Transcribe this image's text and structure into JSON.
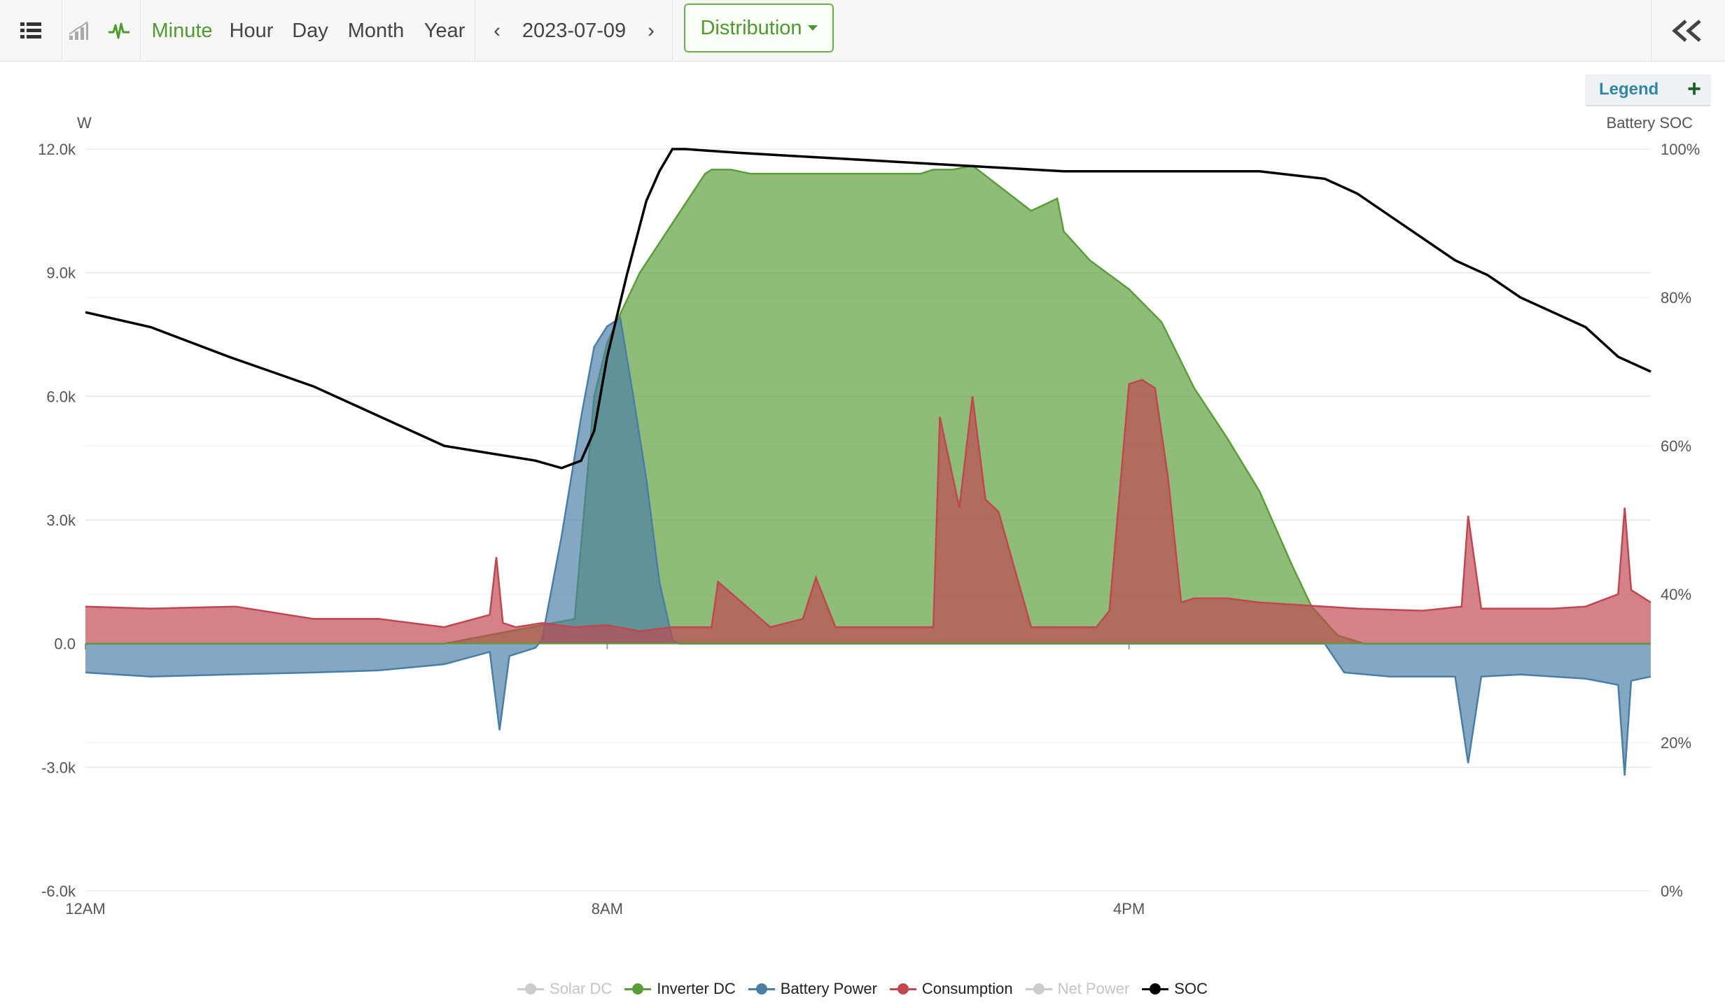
{
  "toolbar": {
    "periods": [
      "Minute",
      "Hour",
      "Day",
      "Month",
      "Year"
    ],
    "active_period": "Minute",
    "prev_label": "‹",
    "date": "2023-07-09",
    "next_label": "›",
    "view_label": "Distribution",
    "collapse_label": "«",
    "icons": [
      "list-icon",
      "bar-chart-icon",
      "pulse-icon"
    ]
  },
  "legend_toggle": {
    "label": "Legend",
    "plus": "+"
  },
  "colors": {
    "accent": "#4d9a2e",
    "inverter": "#5a9e3a",
    "battery": "#4a7ea6",
    "consumption": "#c0474f",
    "soc": "#000000",
    "disabled": "#cccccc"
  },
  "chart_data": {
    "type": "area",
    "title": "",
    "x_ticks": [
      "12AM",
      "8AM",
      "4PM"
    ],
    "x_unit": "hour",
    "xlim": [
      0,
      24
    ],
    "y_left": {
      "label": "W",
      "ticks": [
        "12.0k",
        "9.0k",
        "6.0k",
        "3.0k",
        "0.0",
        "-3.0k",
        "-6.0k"
      ],
      "range": [
        -6000,
        12000
      ]
    },
    "y_right": {
      "label": "Battery SOC",
      "ticks": [
        "100%",
        "80%",
        "60%",
        "40%",
        "20%",
        "0%"
      ],
      "range": [
        0,
        100
      ]
    },
    "grid": true,
    "legend_position": "bottom",
    "series": [
      {
        "name": "Solar DC",
        "enabled": false,
        "x": [],
        "values": []
      },
      {
        "name": "Inverter DC",
        "enabled": true,
        "x": [
          0,
          5.5,
          6.5,
          7.5,
          7.8,
          8.0,
          8.2,
          8.5,
          9.0,
          9.5,
          9.6,
          9.9,
          10.2,
          10.7,
          11.0,
          12.0,
          12.8,
          13.0,
          13.3,
          13.6,
          14.5,
          14.9,
          15.0,
          15.4,
          16.0,
          16.5,
          17.0,
          17.5,
          18.0,
          18.5,
          18.8,
          19.2,
          19.5,
          19.6,
          19.9,
          24
        ],
        "values": [
          0,
          0,
          300,
          600,
          6000,
          7300,
          8000,
          9000,
          10200,
          11400,
          11500,
          11500,
          11400,
          11400,
          11400,
          11400,
          11400,
          11500,
          11500,
          11600,
          10500,
          10800,
          10000,
          9300,
          8600,
          7800,
          6200,
          5000,
          3700,
          1900,
          900,
          200,
          50,
          0,
          0,
          0
        ]
      },
      {
        "name": "Battery Power",
        "enabled": true,
        "x": [
          0,
          1.0,
          2.2,
          3.5,
          4.5,
          5.5,
          6.2,
          6.35,
          6.5,
          6.9,
          7.0,
          7.3,
          7.6,
          7.8,
          8.0,
          8.2,
          8.4,
          8.6,
          8.8,
          9.0,
          9.1,
          19.0,
          19.3,
          20.0,
          21.0,
          21.2,
          21.4,
          22.0,
          23.0,
          23.5,
          23.6,
          23.7,
          24
        ],
        "values": [
          -700,
          -800,
          -750,
          -700,
          -650,
          -500,
          -200,
          -2100,
          -300,
          -100,
          100,
          2600,
          5500,
          7200,
          7700,
          7900,
          6000,
          4000,
          1500,
          100,
          0,
          0,
          -700,
          -800,
          -800,
          -2900,
          -800,
          -750,
          -850,
          -1000,
          -3200,
          -900,
          -800
        ]
      },
      {
        "name": "Consumption",
        "enabled": true,
        "x": [
          0,
          1.0,
          2.3,
          3.5,
          4.5,
          5.5,
          6.2,
          6.3,
          6.4,
          6.6,
          7.0,
          7.5,
          8.0,
          8.5,
          9.0,
          9.6,
          9.7,
          10.5,
          11.0,
          11.2,
          11.5,
          13.0,
          13.1,
          13.4,
          13.6,
          13.8,
          14.0,
          14.5,
          15.5,
          15.7,
          16.0,
          16.2,
          16.4,
          16.6,
          16.8,
          17.0,
          17.5,
          18.0,
          19.0,
          19.5,
          20.5,
          21.1,
          21.2,
          21.4,
          22.5,
          23.0,
          23.5,
          23.6,
          23.7,
          24
        ],
        "values": [
          900,
          850,
          900,
          600,
          600,
          400,
          700,
          2100,
          500,
          400,
          500,
          400,
          450,
          300,
          400,
          400,
          1500,
          400,
          600,
          1600,
          400,
          400,
          5500,
          3300,
          6000,
          3500,
          3200,
          400,
          400,
          800,
          6300,
          6400,
          6200,
          4000,
          1000,
          1100,
          1100,
          1000,
          900,
          850,
          800,
          900,
          3100,
          850,
          850,
          900,
          1200,
          3300,
          1300,
          1000
        ]
      },
      {
        "name": "Net Power",
        "enabled": false,
        "x": [],
        "values": []
      },
      {
        "name": "SOC",
        "enabled": true,
        "axis": "right",
        "x": [
          0,
          1.0,
          2.2,
          3.5,
          4.5,
          5.5,
          6.2,
          6.9,
          7.3,
          7.6,
          7.8,
          8.0,
          8.3,
          8.6,
          8.8,
          9.0,
          9.2,
          10.0,
          11.0,
          12.0,
          13.0,
          14.0,
          15.0,
          16.0,
          17.0,
          18.0,
          18.5,
          19.0,
          19.5,
          20.0,
          20.5,
          21.0,
          21.5,
          22.0,
          22.5,
          23.0,
          23.5,
          24
        ],
        "values": [
          78,
          76,
          72,
          68,
          64,
          60,
          59,
          58,
          57,
          58,
          62,
          72,
          83,
          93,
          97,
          100,
          100,
          99.5,
          99,
          98.5,
          98,
          97.5,
          97,
          97,
          97,
          97,
          96.5,
          96,
          94,
          91,
          88,
          85,
          83,
          80,
          78,
          76,
          72,
          70
        ]
      }
    ]
  }
}
